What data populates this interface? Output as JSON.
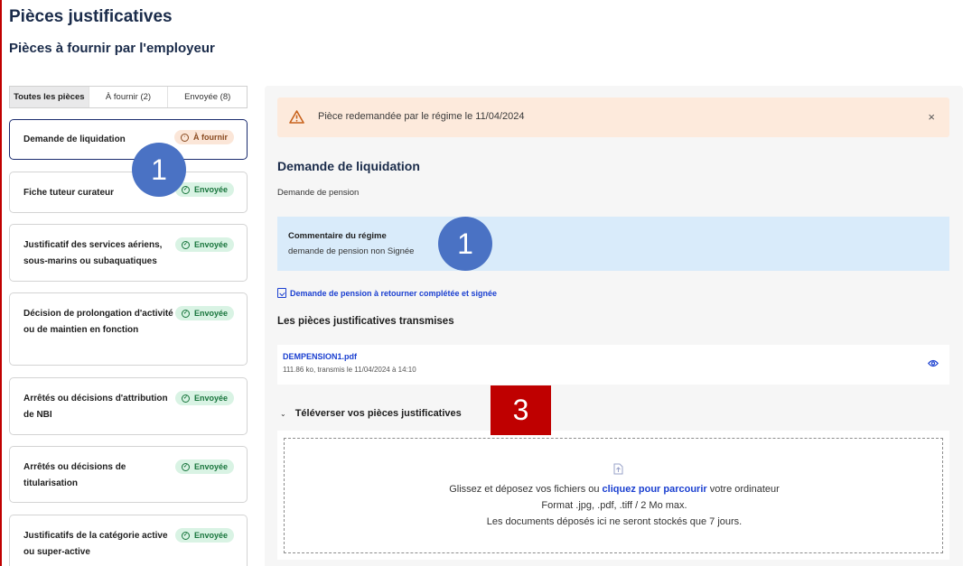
{
  "page": {
    "title": "Pièces justificatives",
    "subtitle": "Pièces à fournir par l'employeur"
  },
  "tabs": [
    {
      "label": "Toutes les pièces",
      "active": true
    },
    {
      "label": "À fournir (2)",
      "active": false
    },
    {
      "label": "Envoyée (8)",
      "active": false
    }
  ],
  "cards": [
    {
      "title": "Demande de liquidation",
      "status": "À fournir",
      "kind": "pending"
    },
    {
      "title": "Fiche tuteur curateur",
      "status": "Envoyée",
      "kind": "ok"
    },
    {
      "title": "Justificatif des services aériens, sous-marins ou subaquatiques",
      "status": "Envoyée",
      "kind": "ok"
    },
    {
      "title": "Décision de prolongation d'activité ou de maintien en fonction",
      "status": "Envoyée",
      "kind": "ok"
    },
    {
      "title": "Arrêtés ou décisions d'attribution de NBI",
      "status": "Envoyée",
      "kind": "ok"
    },
    {
      "title": "Arrêtés ou décisions de titularisation",
      "status": "Envoyée",
      "kind": "ok"
    },
    {
      "title": "Justificatifs de la catégorie active ou super-active",
      "status": "Envoyée",
      "kind": "ok"
    }
  ],
  "detail": {
    "alert_text": "Pièce redemandée par le régime le 11/04/2024",
    "alert_close": "×",
    "title": "Demande de liquidation",
    "subtitle": "Demande de pension",
    "comment_label": "Commentaire du régime",
    "comment_text": "demande de pension non Signée",
    "download_link": "Demande de pension à retourner complétée et signée",
    "transmitted_title": "Les pièces justificatives transmises",
    "file": {
      "name": "DEMPENSION1.pdf",
      "meta": "111.86 ko, transmis le 11/04/2024 à 14:10"
    },
    "upload": {
      "toggle": "⌄",
      "heading": "Téléverser vos pièces justificatives",
      "line1_before": "Glissez et déposez vos fichiers ou ",
      "line1_link": "cliquez pour parcourir",
      "line1_after": " votre ordinateur",
      "line2": "Format .jpg, .pdf, .tiff / 2 Mo max.",
      "line3": "Les documents déposés ici ne seront stockés que 7 jours."
    }
  },
  "markers": {
    "m1": "1",
    "m2": "1",
    "m3": "3"
  },
  "colors": {
    "accent_blue": "#1a3fd0",
    "success_bg": "#d9f3e4",
    "success_text": "#18753c",
    "warning_bg": "#fdeadc",
    "info_bg": "#d9ebfa",
    "marker_blue": "#4a72c4",
    "marker_red": "#bf0000"
  }
}
